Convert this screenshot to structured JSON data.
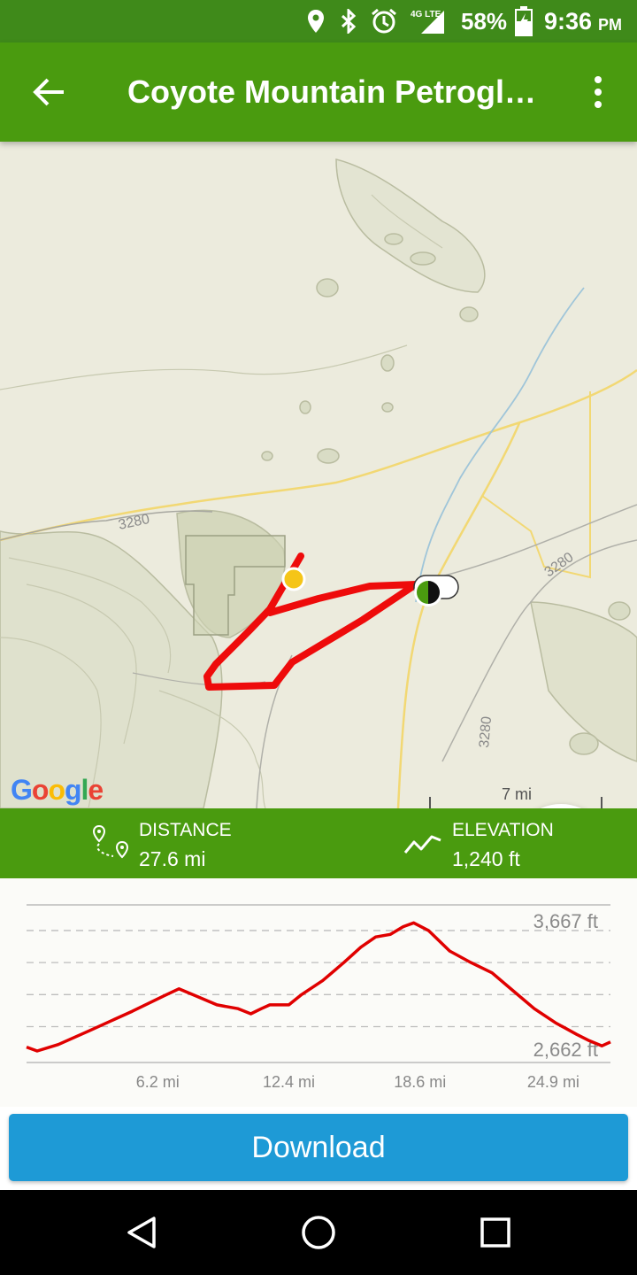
{
  "status_bar": {
    "battery": "58%",
    "time": "9:36",
    "ampm": "PM",
    "network": "4G LTE"
  },
  "app_bar": {
    "title": "Coyote Mountain Petrogl…"
  },
  "map": {
    "road_label_1": "3280",
    "road_label_2": "3280",
    "road_label_3": "3280",
    "scale_label": "7 mi",
    "google_logo": "Google",
    "route_color": "#ee0b0b",
    "start_marker_color": "#f5c518"
  },
  "stats": {
    "distance_label": "DISTANCE",
    "distance_value": "27.6 mi",
    "elevation_label": "ELEVATION",
    "elevation_value": "1,240 ft"
  },
  "chart_data": {
    "type": "line",
    "title": "",
    "xlabel": "",
    "ylabel": "",
    "x_tick_labels": [
      "6.2 mi",
      "12.4 mi",
      "18.6 mi",
      "24.9 mi"
    ],
    "y_tick_labels": [
      "3,667 ft",
      "2,662 ft"
    ],
    "y_ticks": [
      3667,
      2662
    ],
    "xlim": [
      0,
      27.6
    ],
    "ylim": [
      2560,
      3790
    ],
    "grid": true,
    "series": [
      {
        "color": "#e00000",
        "x": [
          0.0,
          0.5,
          1.5,
          3.0,
          5.0,
          6.5,
          7.2,
          8.0,
          9.0,
          10.0,
          10.6,
          11.1,
          11.5,
          11.9,
          12.4,
          13.0,
          14.0,
          15.0,
          15.8,
          16.5,
          17.2,
          17.8,
          18.3,
          19.0,
          20.0,
          21.0,
          22.0,
          23.0,
          24.0,
          25.0,
          26.0,
          26.6,
          27.2,
          27.6
        ],
        "y": [
          2680,
          2650,
          2700,
          2810,
          2960,
          3080,
          3135,
          3080,
          3010,
          2980,
          2940,
          2980,
          3010,
          3010,
          3010,
          3090,
          3200,
          3340,
          3460,
          3540,
          3560,
          3620,
          3650,
          3590,
          3430,
          3340,
          3260,
          3120,
          2980,
          2870,
          2780,
          2730,
          2690,
          2720
        ]
      }
    ]
  },
  "download_button": {
    "label": "Download"
  },
  "colors": {
    "status_bar": "#3f8a1a",
    "app_bar": "#4a9b0f",
    "accent_blue": "#1e9ad6"
  },
  "icons": {
    "back": "arrow-left-icon",
    "more": "more-vert-icon",
    "zoom": "plus-icon",
    "distance": "route-pin-icon",
    "elevation": "trend-line-icon",
    "nav_back": "triangle-back-icon",
    "nav_home": "circle-home-icon",
    "nav_recents": "square-recents-icon"
  }
}
